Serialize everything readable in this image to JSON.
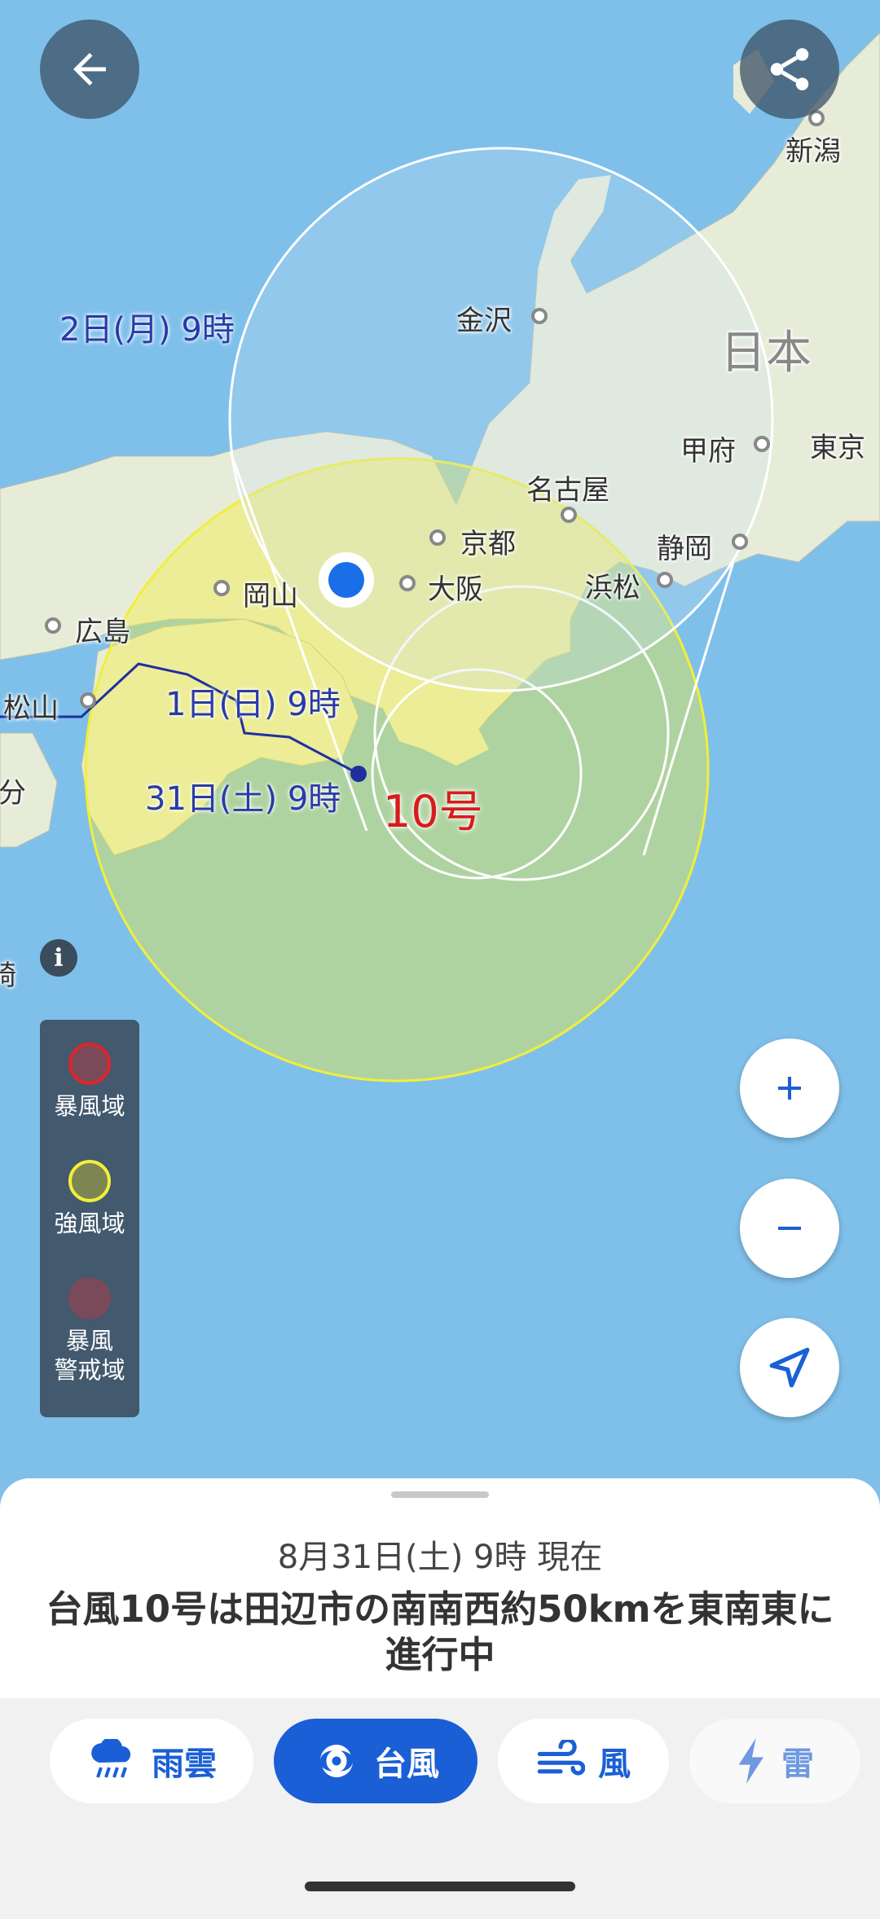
{
  "map": {
    "cities": [
      {
        "name": "新潟"
      },
      {
        "name": "金沢"
      },
      {
        "name": "日本"
      },
      {
        "name": "甲府"
      },
      {
        "name": "東京"
      },
      {
        "name": "名古屋"
      },
      {
        "name": "京都"
      },
      {
        "name": "静岡"
      },
      {
        "name": "大阪"
      },
      {
        "name": "浜松"
      },
      {
        "name": "岡山"
      },
      {
        "name": "広島"
      },
      {
        "name": "松山"
      },
      {
        "name": "大分"
      },
      {
        "name": "崎"
      }
    ],
    "track_labels": [
      "2日(月) 9時",
      "1日(日) 9時",
      "31日(土) 9時"
    ],
    "typhoon_label": "10号"
  },
  "legend": {
    "items": [
      {
        "label": "暴風域",
        "color": "#e0242a"
      },
      {
        "label": "強風域",
        "color": "#f2ee3a"
      },
      {
        "label": "暴風警戒域",
        "color": "#7a4a5a"
      }
    ],
    "item3_lines": [
      "暴風",
      "警戒域"
    ]
  },
  "status": {
    "timestamp": "8月31日(土) 9時 現在",
    "headline": "台風10号は田辺市の南南西約50kmを東南東に進行中"
  },
  "tabs": [
    {
      "label": "雨雲",
      "icon": "rain-cloud-icon",
      "active": false
    },
    {
      "label": "台風",
      "icon": "typhoon-icon",
      "active": true
    },
    {
      "label": "風",
      "icon": "wind-icon",
      "active": false
    },
    {
      "label": "雷",
      "icon": "lightning-icon",
      "active": false
    }
  ],
  "colors": {
    "accent": "#1a5fd6",
    "sea": "#7fc0ea",
    "strong_wind_area": "#f2ee3a",
    "track": "#1f2fa0",
    "typhoon_label": "#d81b1b"
  }
}
